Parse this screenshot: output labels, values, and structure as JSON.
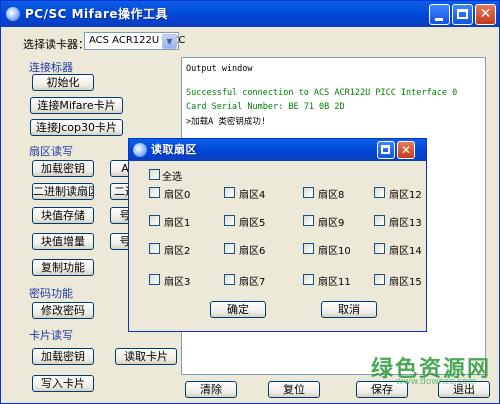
{
  "window": {
    "title": "PC/SC Mifare操作工具",
    "buttons": [
      "minimize",
      "maximize",
      "close"
    ]
  },
  "reader": {
    "label": "选择读卡器：",
    "selected": "ACS ACR122U PICC"
  },
  "sections": {
    "connect": {
      "title": "连接标器",
      "buttons": [
        "初始化",
        "连接Mifare卡片",
        "连接Jcop30卡片"
      ]
    },
    "sector_rw": {
      "title": "扇区读写",
      "buttons": [
        "加载密钥",
        "二进制读扇区",
        "块值存储",
        "块值增量",
        "复制功能"
      ],
      "partial_buttons": [
        "A",
        "二进",
        "号",
        "号"
      ]
    },
    "password": {
      "title": "密码功能",
      "buttons": [
        "修改密码"
      ]
    },
    "card_rw": {
      "title": "卡片读写",
      "buttons": [
        "加载密钥",
        "读取卡片",
        "写入卡片"
      ]
    }
  },
  "output": {
    "lines": [
      "Output window",
      "",
      "Successful connection to ACS ACR122U PICC Interface 0",
      "Card Serial Number:  BE 71 0B 2D",
      ">加载A 类密钥成功!"
    ]
  },
  "bottom_buttons": [
    "清除",
    "复位",
    "保存",
    "退出"
  ],
  "dialog": {
    "title": "读取扇区",
    "select_all": "全选",
    "sectors": [
      "扇区0",
      "扇区1",
      "扇区2",
      "扇区3",
      "扇区4",
      "扇区5",
      "扇区6",
      "扇区7",
      "扇区8",
      "扇区9",
      "扇区10",
      "扇区11",
      "扇区12",
      "扇区13",
      "扇区14",
      "扇区15"
    ],
    "ok": "确定",
    "cancel": "取消"
  },
  "watermark": {
    "text": "绿色资源网",
    "url": "www.downcc.com"
  },
  "colors": {
    "titlebar": "#0054E3",
    "window_bg": "#ECE9D8",
    "section_title": "#223AA8",
    "output_text": "#008000",
    "watermark": "#2C9A3A"
  }
}
